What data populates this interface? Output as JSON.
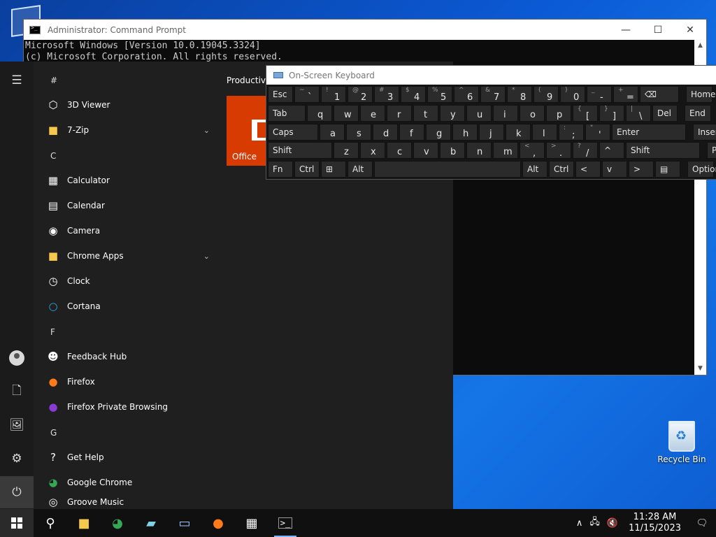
{
  "desktop": {
    "recycle_bin_label": "Recycle Bin"
  },
  "cmd": {
    "title": "Administrator: Command Prompt",
    "lines": [
      "Microsoft Windows [Version 10.0.19045.3324]",
      "(c) Microsoft Corporation. All rights reserved."
    ],
    "min": "—",
    "max": "☐",
    "close": "✕",
    "scroll_up": "▲",
    "scroll_down": "▼"
  },
  "start": {
    "rail": {
      "menu": "☰",
      "documents": "🗋",
      "pictures": "🖼",
      "settings": "⚙",
      "power": "⏻"
    },
    "letters": {
      "hash": "#",
      "c": "C",
      "f": "F",
      "g": "G"
    },
    "apps": {
      "viewer": "3D Viewer",
      "zip": "7-Zip",
      "calculator": "Calculator",
      "calendar": "Calendar",
      "camera": "Camera",
      "chrome_apps": "Chrome Apps",
      "clock": "Clock",
      "cortana": "Cortana",
      "feedback": "Feedback Hub",
      "firefox": "Firefox",
      "firefox_private": "Firefox Private Browsing",
      "get_help": "Get Help",
      "chrome": "Google Chrome",
      "groove": "Groove Music"
    },
    "chevron": "⌄",
    "tiles_header": "Productivit",
    "office_label": "Office"
  },
  "osk": {
    "title": "On-Screen Keyboard",
    "row1": [
      {
        "m": "Esc"
      },
      {
        "t": "~",
        "b": "`"
      },
      {
        "t": "!",
        "b": "1"
      },
      {
        "t": "@",
        "b": "2"
      },
      {
        "t": "#",
        "b": "3"
      },
      {
        "t": "$",
        "b": "4"
      },
      {
        "t": "%",
        "b": "5"
      },
      {
        "t": "^",
        "b": "6"
      },
      {
        "t": "&",
        "b": "7"
      },
      {
        "t": "*",
        "b": "8"
      },
      {
        "t": "(",
        "b": "9"
      },
      {
        "t": ")",
        "b": "0"
      },
      {
        "t": "_",
        "b": "-"
      },
      {
        "t": "+",
        "b": "="
      },
      {
        "m": "⌫"
      },
      {
        "m": "Home"
      }
    ],
    "row2": [
      {
        "m": "Tab"
      },
      {
        "l": "q"
      },
      {
        "l": "w"
      },
      {
        "l": "e"
      },
      {
        "l": "r"
      },
      {
        "l": "t"
      },
      {
        "l": "y"
      },
      {
        "l": "u"
      },
      {
        "l": "i"
      },
      {
        "l": "o"
      },
      {
        "l": "p"
      },
      {
        "t": "{",
        "b": "["
      },
      {
        "t": "}",
        "b": "]"
      },
      {
        "t": "|",
        "b": "\\"
      },
      {
        "m": "Del"
      },
      {
        "m": "End"
      }
    ],
    "row3": [
      {
        "m": "Caps"
      },
      {
        "l": "a"
      },
      {
        "l": "s"
      },
      {
        "l": "d"
      },
      {
        "l": "f"
      },
      {
        "l": "g"
      },
      {
        "l": "h"
      },
      {
        "l": "j"
      },
      {
        "l": "k"
      },
      {
        "l": "l"
      },
      {
        "t": ":",
        "b": ";"
      },
      {
        "t": "\"",
        "b": "'"
      },
      {
        "m": "Enter"
      },
      {
        "m": "Insert"
      }
    ],
    "row4": [
      {
        "m": "Shift"
      },
      {
        "l": "z"
      },
      {
        "l": "x"
      },
      {
        "l": "c"
      },
      {
        "l": "v"
      },
      {
        "l": "b"
      },
      {
        "l": "n"
      },
      {
        "l": "m"
      },
      {
        "t": "<",
        "b": ","
      },
      {
        "t": ">",
        "b": "."
      },
      {
        "t": "?",
        "b": "/"
      },
      {
        "m": "^"
      },
      {
        "m": "Shift"
      },
      {
        "m": "PrtScn"
      }
    ],
    "row5": [
      {
        "m": "Fn"
      },
      {
        "m": "Ctrl"
      },
      {
        "m": "⊞"
      },
      {
        "m": "Alt"
      },
      {
        "m": ""
      },
      {
        "m": "Alt"
      },
      {
        "m": "Ctrl"
      },
      {
        "m": "<"
      },
      {
        "m": "v"
      },
      {
        "m": ">"
      },
      {
        "m": "▤"
      },
      {
        "m": "Options"
      }
    ]
  },
  "taskbar": {
    "search": "⚲",
    "tray_up": "∧",
    "network": "🖧",
    "volume": "🔇",
    "time": "11:28 AM",
    "date": "11/15/2023",
    "notifications": "🗨"
  }
}
